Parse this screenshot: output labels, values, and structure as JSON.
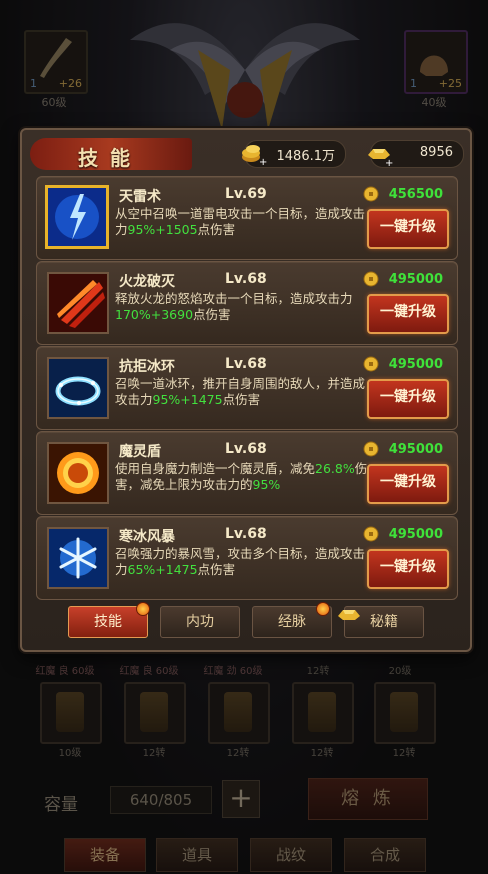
{
  "background": {
    "weapon_slot": {
      "level_num": "1",
      "plus": "+26",
      "caption": "60级"
    },
    "helmet_slot": {
      "level_num": "1",
      "plus": "+25",
      "caption": "40级"
    },
    "row1_names": [
      "红魔 良 60级",
      "红魔 良 60级",
      "红魔 劲 60级",
      "12转",
      "20级"
    ],
    "row2_labels": [
      "10级",
      "12转",
      "12转",
      "12转",
      "12转"
    ],
    "capacity": {
      "label": "容量",
      "value": "640/805",
      "plus": "+",
      "smelt": "熔 炼"
    },
    "bottom_tabs": [
      "装备",
      "道具",
      "战纹",
      "合成"
    ]
  },
  "panel": {
    "title": "技能",
    "currency": [
      {
        "icon": "gold-coin-stack-icon",
        "value": "1486.1万"
      },
      {
        "icon": "gold-ingot-icon",
        "value": "8956"
      }
    ],
    "upgrade_label": "一键升级",
    "skills": [
      {
        "name": "天雷术",
        "level": "Lv.69",
        "cost": "456500",
        "icon": "lightning-icon",
        "desc_parts": [
          "从空中召唤一道雷电攻击一个目标，造成攻击力",
          "95%+1505",
          "点伤害"
        ]
      },
      {
        "name": "火龙破灭",
        "level": "Lv.68",
        "cost": "495000",
        "icon": "fire-dragon-icon",
        "desc_parts": [
          "释放火龙的怒焰攻击一个目标，造成攻击力",
          "170%+3690",
          "点伤害"
        ]
      },
      {
        "name": "抗拒冰环",
        "level": "Lv.68",
        "cost": "495000",
        "icon": "ice-ring-icon",
        "desc_parts": [
          "召唤一道冰环，推开自身周围的敌人，并造成攻击力",
          "95%+1475",
          "点伤害"
        ]
      },
      {
        "name": "魔灵盾",
        "level": "Lv.68",
        "cost": "495000",
        "icon": "magic-shield-icon",
        "desc_parts": [
          "使用自身魔力制造一个魔灵盾，减免",
          "26.8%",
          "伤害，减免上限为攻击力的",
          "95%",
          ""
        ]
      },
      {
        "name": "寒冰风暴",
        "level": "Lv.68",
        "cost": "495000",
        "icon": "ice-storm-icon",
        "desc_parts": [
          "召唤强力的暴风雪，攻击多个目标，造成攻击力",
          "65%+1475",
          "点伤害"
        ]
      }
    ],
    "tabs": [
      {
        "label": "技能",
        "active": true,
        "dot": true
      },
      {
        "label": "内功",
        "active": false,
        "dot": false
      },
      {
        "label": "经脉",
        "active": false,
        "dot": true
      },
      {
        "label": "秘籍",
        "active": false,
        "dot": false
      }
    ]
  }
}
